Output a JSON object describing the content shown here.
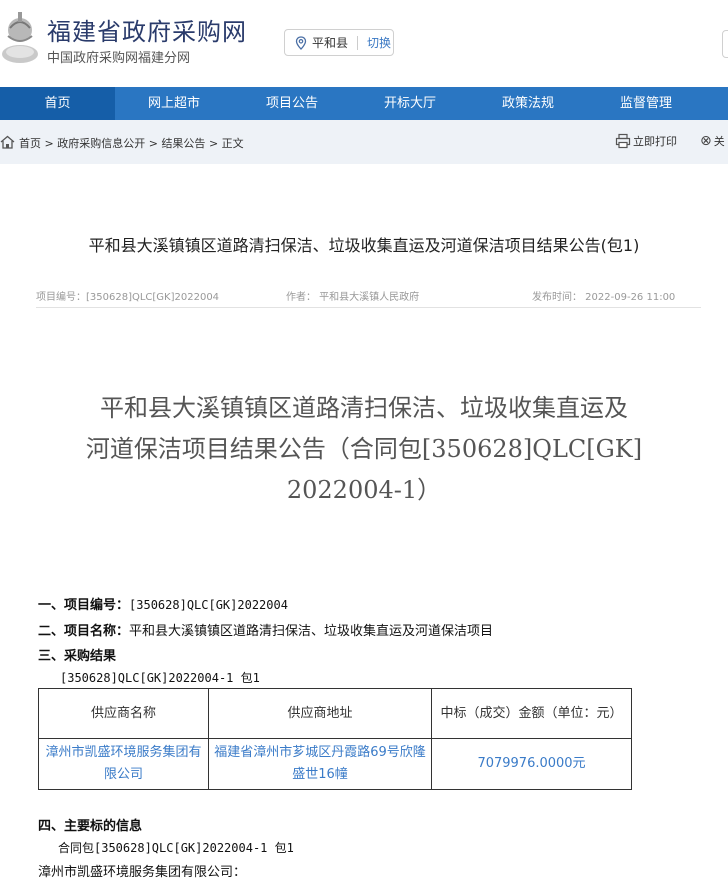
{
  "header": {
    "title": "福建省政府采购网",
    "subtitle": "中国政府采购网福建分网",
    "location": {
      "city": "平和县",
      "switch_label": "切换"
    }
  },
  "nav": {
    "items": [
      "首页",
      "网上超市",
      "项目公告",
      "开标大厅",
      "政策法规",
      "监督管理"
    ]
  },
  "breadcrumb": {
    "items": [
      "首页",
      "政府采购信息公开",
      "结果公告",
      "正文"
    ],
    "separator": ">",
    "print_label": "立即打印",
    "close_label": "关"
  },
  "article": {
    "title": "平和县大溪镇镇区道路清扫保洁、垃圾收集直运及河道保洁项目结果公告(包1)",
    "meta": {
      "project_no": "项目编号：[350628]QLC[GK]2022004",
      "author": "作者： 平和县大溪镇人民政府",
      "published": "发布时间： 2022-09-26 11:00"
    },
    "big_title_lines": [
      "平和县大溪镇镇区道路清扫保洁、垃圾收集直运及",
      "河道保洁项目结果公告（合同包[350628]QLC[GK]",
      "2022004-1）"
    ],
    "section1_label": "一、项目编号：",
    "section1_value": "[350628]QLC[GK]2022004",
    "section2_label": "二、项目名称：",
    "section2_value": "平和县大溪镇镇区道路清扫保洁、垃圾收集直运及河道保洁项目",
    "section3_label": "三、采购结果",
    "package_label": "[350628]QLC[GK]2022004-1 包1",
    "table": {
      "headers": [
        "供应商名称",
        "供应商地址",
        "中标（成交）金额（单位：元）"
      ],
      "rows": [
        {
          "name": "漳州市凯盛环境服务集团有限公司",
          "address": "福建省漳州市芗城区丹霞路69号欣隆盛世16幢",
          "amount": "7079976.0000元"
        }
      ]
    },
    "section4_label": "四、主要标的信息",
    "section4_package": "合同包[350628]QLC[GK]2022004-1 包1",
    "section4_supplier": "漳州市凯盛环境服务集团有限公司："
  }
}
